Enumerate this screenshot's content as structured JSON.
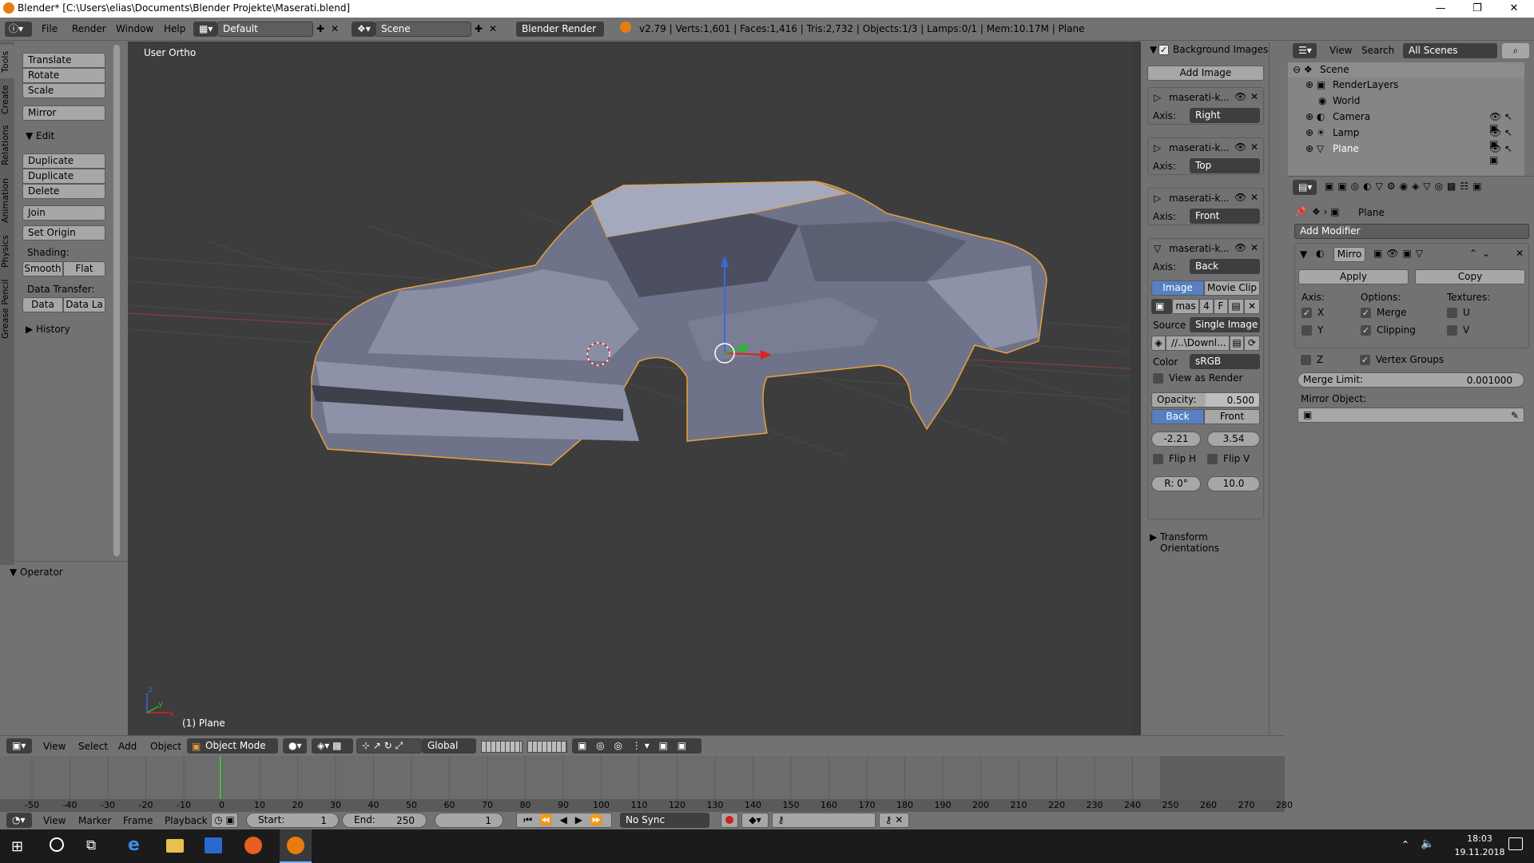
{
  "window": {
    "title": "Blender* [C:\\Users\\elias\\Documents\\Blender Projekte\\Maserati.blend]",
    "minimize": "—",
    "maximize": "❐",
    "close": "✕"
  },
  "topbar": {
    "menus": [
      "File",
      "Render",
      "Window",
      "Help"
    ],
    "layout": "Default",
    "scene": "Scene",
    "engine": "Blender Render",
    "stats": "v2.79 | Verts:1,601 | Faces:1,416 | Tris:2,732 | Objects:1/3 | Lamps:0/1 | Mem:10.17M | Plane"
  },
  "tabs": [
    "Tools",
    "Create",
    "Relations",
    "Animation",
    "Physics",
    "Grease Pencil"
  ],
  "toolshelf": {
    "transform": [
      "Translate",
      "Rotate",
      "Scale"
    ],
    "mirror": "Mirror",
    "edit_header": "Edit",
    "edit": [
      "Duplicate",
      "Duplicate Linked",
      "Delete"
    ],
    "join": "Join",
    "set_origin": "Set Origin",
    "shading_label": "Shading:",
    "smooth": "Smooth",
    "flat": "Flat",
    "data_transfer_label": "Data Transfer:",
    "data": "Data",
    "data_la": "Data La",
    "history": "History",
    "operator": "Operator"
  },
  "viewport": {
    "label": "User Ortho",
    "object": "(1) Plane"
  },
  "npanel": {
    "bg_header": "Background Images",
    "add_image": "Add Image",
    "axis_label": "Axis:",
    "images": [
      {
        "name": "maserati-k...",
        "axis": "Right"
      },
      {
        "name": "maserati-k...",
        "axis": "Top"
      },
      {
        "name": "maserati-k...",
        "axis": "Front"
      },
      {
        "name": "maserati-k...",
        "axis": "Back"
      }
    ],
    "image_tab": "Image",
    "movie_tab": "Movie Clip",
    "img_name": "mas",
    "img_users": "4",
    "img_f": "F",
    "source_label": "Source",
    "source": "Single Image",
    "path": "//..\\Downl...",
    "color_label": "Color",
    "color": "sRGB",
    "view_as_render": "View as Render",
    "opacity_label": "Opacity:",
    "opacity": "0.500",
    "back": "Back",
    "front": "Front",
    "off_x": "-2.21",
    "off_y": "3.54",
    "flip_h": "Flip H",
    "flip_v": "Flip V",
    "rot": "R: 0°",
    "size": "10.0",
    "transform_orient": "Transform Orientations"
  },
  "outliner": {
    "view": "View",
    "search": "Search",
    "scenes": "All Scenes",
    "items": [
      "Scene",
      "RenderLayers",
      "World",
      "Camera",
      "Lamp",
      "Plane"
    ]
  },
  "props": {
    "object": "Plane",
    "add_modifier": "Add Modifier",
    "mod_name": "Mirro",
    "apply": "Apply",
    "copy": "Copy",
    "axis_label": "Axis:",
    "options_label": "Options:",
    "textures_label": "Textures:",
    "axes": [
      "X",
      "Y",
      "Z"
    ],
    "options": [
      "Merge",
      "Clipping",
      "Vertex Groups"
    ],
    "textures": [
      "U",
      "V"
    ],
    "merge_limit_label": "Merge Limit:",
    "merge_limit": "0.001000",
    "mirror_object_label": "Mirror Object:"
  },
  "vpheader": {
    "menus": [
      "View",
      "Select",
      "Add",
      "Object"
    ],
    "mode": "Object Mode",
    "orientation": "Global"
  },
  "timeline": {
    "ticks": [
      "-50",
      "-40",
      "-30",
      "-20",
      "-10",
      "0",
      "10",
      "20",
      "30",
      "40",
      "50",
      "60",
      "70",
      "80",
      "90",
      "100",
      "110",
      "120",
      "130",
      "140",
      "150",
      "160",
      "170",
      "180",
      "190",
      "200",
      "210",
      "220",
      "230",
      "240",
      "250",
      "260",
      "270",
      "280"
    ]
  },
  "tlheader": {
    "menus": [
      "View",
      "Marker",
      "Frame",
      "Playback"
    ],
    "start_label": "Start:",
    "start": "1",
    "end_label": "End:",
    "end": "250",
    "current": "1",
    "sync": "No Sync"
  },
  "taskbar": {
    "time": "18:03",
    "date": "19.11.2018"
  }
}
